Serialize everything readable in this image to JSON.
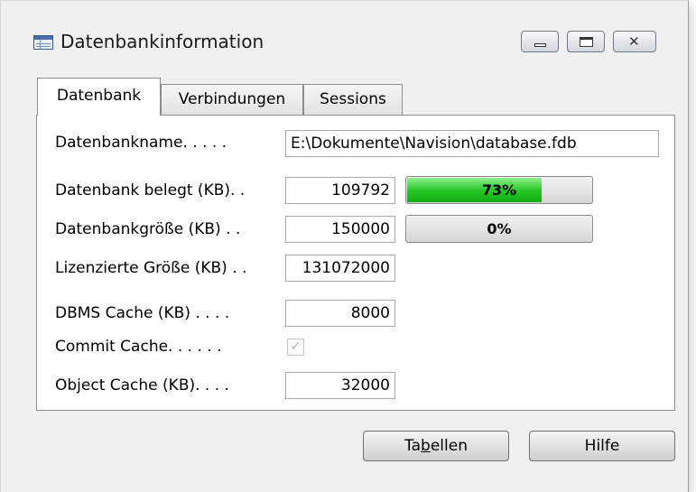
{
  "window": {
    "title": "Datenbankinformation",
    "icon": "table-grid-icon",
    "caption_close_glyph": "✕"
  },
  "tabs": [
    {
      "label": "Datenbank",
      "active": true
    },
    {
      "label": "Verbindungen",
      "active": false
    },
    {
      "label": "Sessions",
      "active": false
    }
  ],
  "fields": {
    "database_name": {
      "label": "Datenbankname. . . . .",
      "value": "E:\\Dokumente\\Navision\\database.fdb"
    },
    "db_used": {
      "label": "Datenbank belegt (KB). .",
      "value": "109792",
      "progress_text": "73%",
      "progress_fraction": 0.73
    },
    "db_size": {
      "label": "Datenbankgröße (KB) . .",
      "value": "150000",
      "progress_text": "0%",
      "progress_fraction": 0.0
    },
    "licensed_size": {
      "label": "Lizenzierte Größe (KB) . .",
      "value": "131072000"
    },
    "dbms_cache": {
      "label": "DBMS Cache (KB) . . . .",
      "value": "8000"
    },
    "commit_cache": {
      "label": "Commit Cache. . . . . .",
      "checked": true,
      "check_glyph": "✓"
    },
    "object_cache": {
      "label": "Object Cache (KB). . . .",
      "value": "32000"
    }
  },
  "buttons": {
    "tables": {
      "prefix": "Ta",
      "mnemonic": "b",
      "suffix": "ellen"
    },
    "help": {
      "label": "Hilfe"
    }
  },
  "colors": {
    "progress_fill": "#28c828",
    "window_bg": "#f0f0f0"
  }
}
